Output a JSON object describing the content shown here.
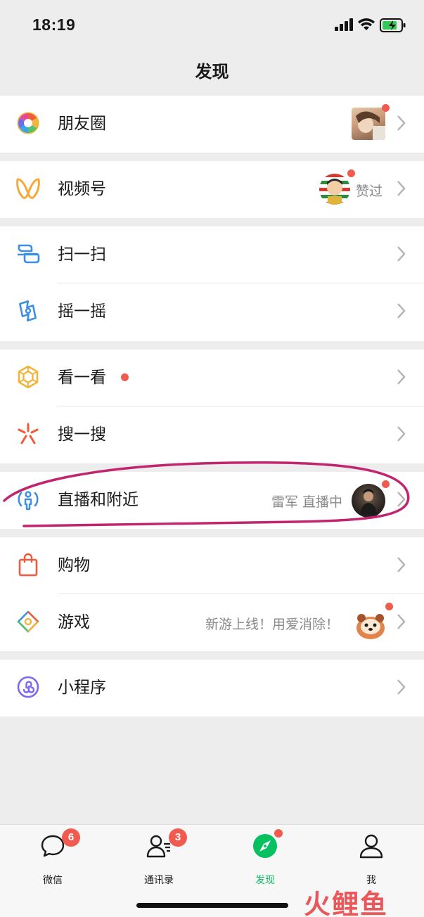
{
  "status": {
    "time": "18:19"
  },
  "nav": {
    "title": "发现"
  },
  "rows": {
    "moments": {
      "label": "朋友圈"
    },
    "channels": {
      "label": "视频号",
      "sub": "赞过"
    },
    "scan": {
      "label": "扫一扫"
    },
    "shake": {
      "label": "摇一摇"
    },
    "topstories": {
      "label": "看一看"
    },
    "search": {
      "label": "搜一搜"
    },
    "live": {
      "label": "直播和附近",
      "sub": "雷军 直播中"
    },
    "shopping": {
      "label": "购物"
    },
    "games": {
      "label": "游戏",
      "sub": "新游上线！用爱消除！"
    },
    "miniprograms": {
      "label": "小程序"
    }
  },
  "tabs": [
    {
      "label": "微信",
      "badge": "6"
    },
    {
      "label": "通讯录",
      "badge": "3"
    },
    {
      "label": "发现"
    },
    {
      "label": "我"
    }
  ],
  "colors": {
    "accent_green": "#07c160",
    "badge_red": "#f05a4f",
    "annotation": "#c2256f"
  },
  "watermark": "火鲤鱼"
}
